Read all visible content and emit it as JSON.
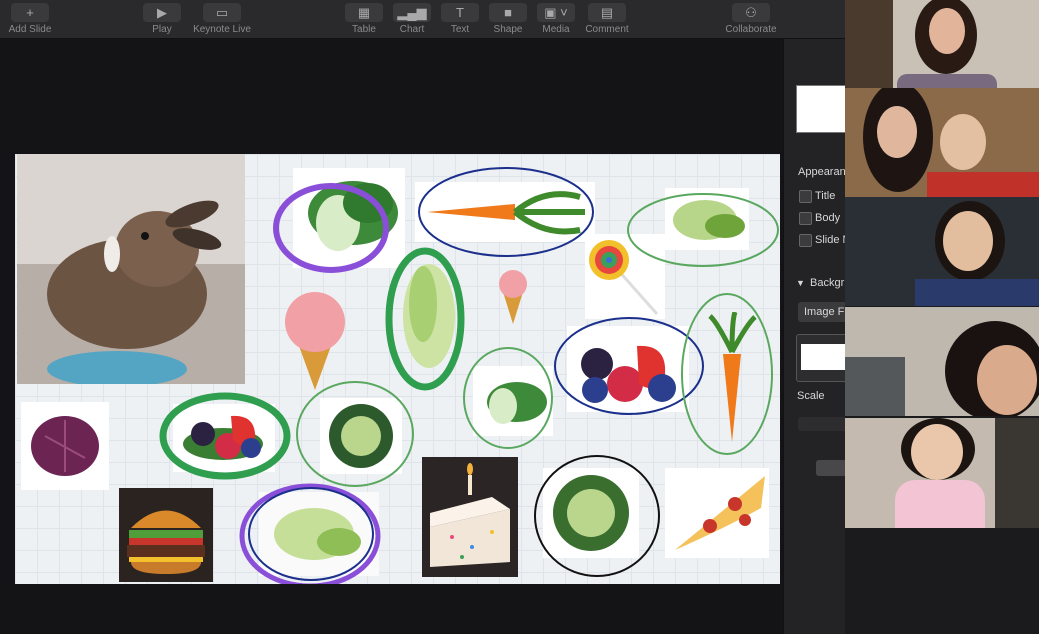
{
  "toolbar": {
    "add_slide": "Add Slide",
    "play": "Play",
    "keynote_live": "Keynote Live",
    "table": "Table",
    "chart": "Chart",
    "text": "Text",
    "shape": "Shape",
    "media": "Media",
    "comment": "Comment",
    "collaborate": "Collaborate"
  },
  "inspector": {
    "appearance": "Appearan",
    "title": "Title",
    "body": "Body",
    "slide_number": "Slide N",
    "background": "Backgr",
    "image_fill": "Image F",
    "scale": "Scale"
  },
  "slide": {
    "items": [
      {
        "name": "rabbit-photo"
      },
      {
        "name": "bok-choy"
      },
      {
        "name": "carrot"
      },
      {
        "name": "lettuce"
      },
      {
        "name": "napa-cabbage"
      },
      {
        "name": "ice-cream-cone"
      },
      {
        "name": "ice-cream-cone-small"
      },
      {
        "name": "lollipop"
      },
      {
        "name": "mixed-berries"
      },
      {
        "name": "carrot-vertical"
      },
      {
        "name": "red-cabbage"
      },
      {
        "name": "berries-bowl"
      },
      {
        "name": "green-cabbage"
      },
      {
        "name": "bok-choy-small"
      },
      {
        "name": "burger"
      },
      {
        "name": "lettuce-head"
      },
      {
        "name": "birthday-cake"
      },
      {
        "name": "cabbage-head"
      },
      {
        "name": "pizza-slice"
      }
    ]
  },
  "participants": [
    {
      "name": "participant-1"
    },
    {
      "name": "participant-2"
    },
    {
      "name": "participant-3"
    },
    {
      "name": "participant-4"
    },
    {
      "name": "participant-5"
    }
  ],
  "colors": {
    "annotation_purple": "#8a4fd8",
    "annotation_green": "#2f9e4f",
    "annotation_light_green": "#5aa860",
    "annotation_blue": "#1b2f8c",
    "annotation_black": "#111111"
  }
}
